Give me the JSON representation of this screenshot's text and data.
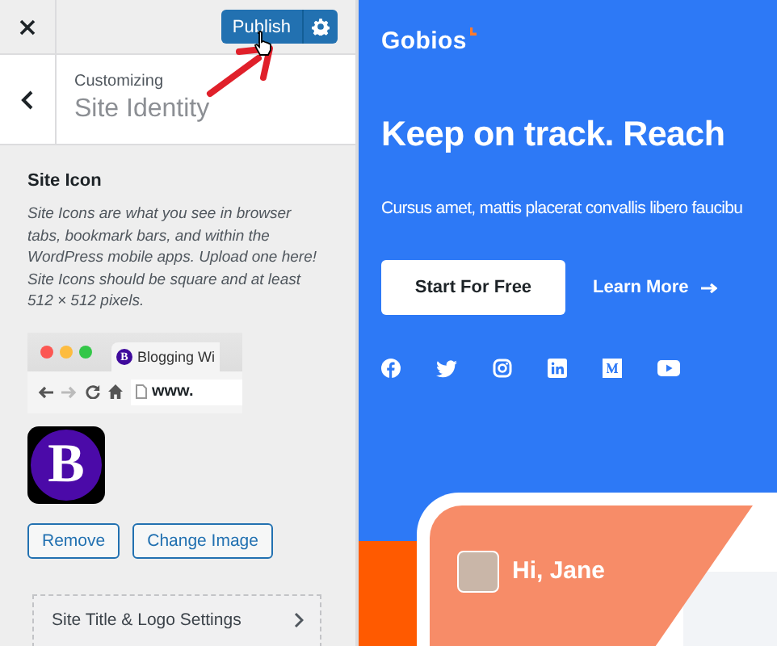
{
  "customizer": {
    "publish_button": "Publish",
    "header": {
      "subtitle": "Customizing",
      "title": "Site Identity"
    },
    "site_icon": {
      "heading": "Site Icon",
      "description": "Site Icons are what you see in browser tabs, bookmark bars, and within the WordPress mobile apps. Upload one here! Site Icons should be square and at least 512 × 512 pixels.",
      "browser_tab_title": "Blogging Wi",
      "favicon_letter": "B",
      "address": "www.",
      "icon_letter": "B",
      "buttons": [
        "Remove",
        "Change Image"
      ]
    },
    "sections": [
      {
        "label": "Site Title & Logo Settings"
      }
    ]
  },
  "preview": {
    "logo": "Gobios",
    "headline": "Keep on track. Reach",
    "text": "Cursus amet, mattis placerat convallis libero faucibu",
    "buttons": [
      {
        "label": "Start For Free",
        "kind": "primary"
      },
      {
        "label": "Learn More",
        "kind": "link"
      }
    ],
    "card": {
      "greeting": "Hi, Jane"
    }
  }
}
